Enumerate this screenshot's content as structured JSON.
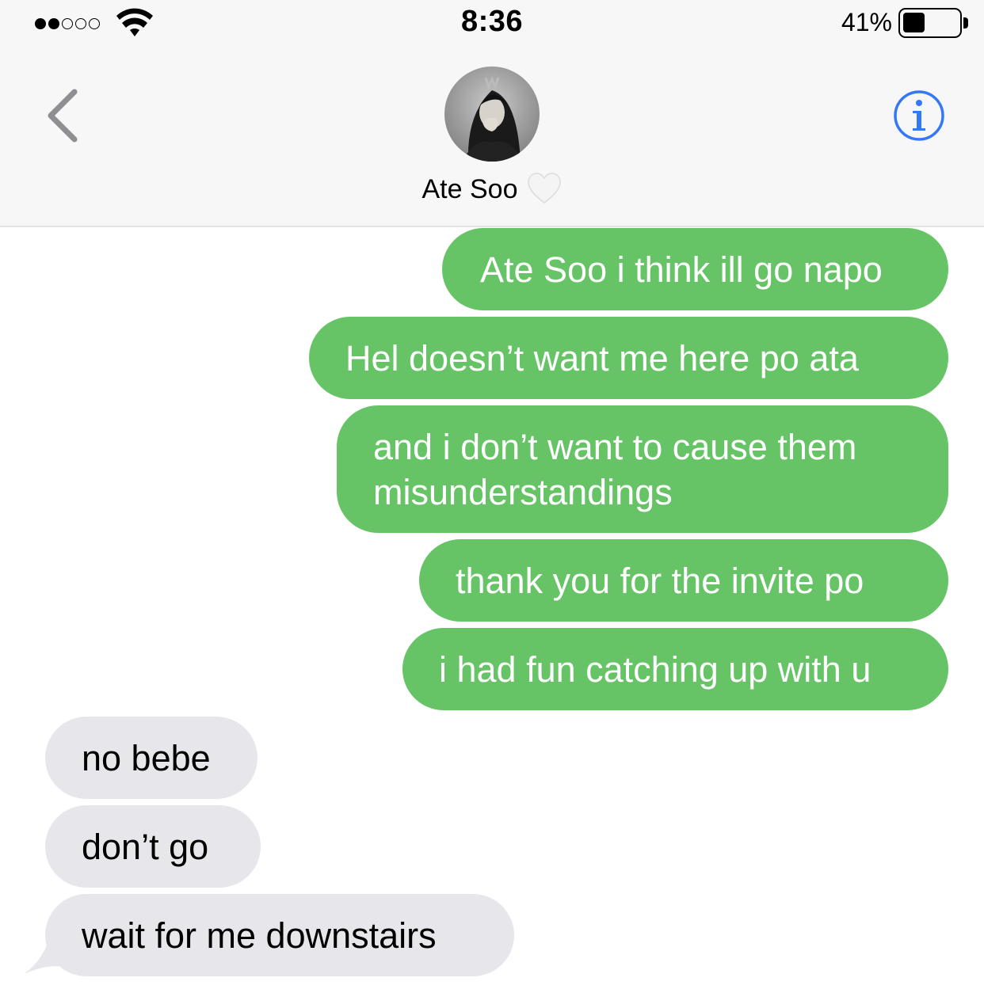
{
  "status_bar": {
    "time": "8:36",
    "battery_percent": "41%",
    "battery_level": 0.41,
    "signal_bars_filled": 2,
    "signal_bars_total": 5
  },
  "nav": {
    "contact_name": "Ate Soo",
    "back_icon": "chevron-left-icon",
    "info_icon": "info-icon",
    "heart_icon": "white-heart-emoji",
    "accent_color": "#3478f6"
  },
  "messages": [
    {
      "direction": "outgoing",
      "text": "Ate Soo i think ill go napo"
    },
    {
      "direction": "outgoing",
      "text": "Hel doesn’t want me here po ata"
    },
    {
      "direction": "outgoing",
      "text": "and i don’t want to cause them misunderstandings"
    },
    {
      "direction": "outgoing",
      "text": "thank you for the invite po"
    },
    {
      "direction": "outgoing",
      "text": "i had fun catching up with u"
    },
    {
      "direction": "incoming",
      "text": "no bebe"
    },
    {
      "direction": "incoming",
      "text": "don’t go"
    },
    {
      "direction": "incoming",
      "text": "wait for me downstairs"
    }
  ],
  "colors": {
    "outgoing_bubble": "#66c466",
    "incoming_bubble": "#e6e6eb",
    "header_background": "#f7f7f7"
  }
}
